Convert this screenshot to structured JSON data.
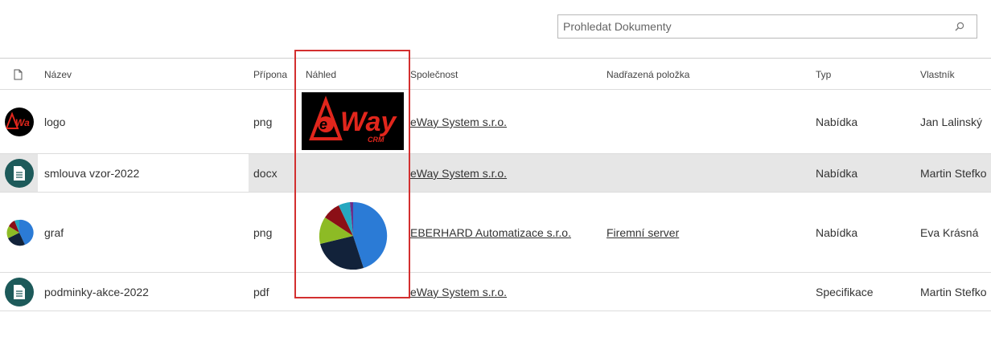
{
  "search": {
    "placeholder": "Prohledat Dokumenty"
  },
  "columns": {
    "name": "Název",
    "extension": "Přípona",
    "preview": "Náhled",
    "company": "Společnost",
    "parent": "Nadřazená položka",
    "type": "Typ",
    "owner": "Vlastník"
  },
  "rows": [
    {
      "name": "logo",
      "extension": "png",
      "company": "eWay System s.r.o.",
      "parent": "",
      "type": "Nabídka",
      "owner": "Jan Lalinský",
      "preview": "eway-logo",
      "avatar": "eway-logo"
    },
    {
      "name": "smlouva vzor-2022",
      "extension": "docx",
      "company": "eWay System s.r.o.",
      "parent": "",
      "type": "Nabídka",
      "owner": "Martin Stefko",
      "preview": "none",
      "avatar": "document-icon"
    },
    {
      "name": "graf",
      "extension": "png",
      "company": "EBERHARD Automatizace s.r.o.",
      "parent": "Firemní server",
      "type": "Nabídka",
      "owner": "Eva Krásná",
      "preview": "pie-chart",
      "avatar": "pie-chart"
    },
    {
      "name": "podminky-akce-2022",
      "extension": "pdf",
      "company": "eWay System s.r.o.",
      "parent": "",
      "type": "Specifikace",
      "owner": "Martin Stefko",
      "preview": "none",
      "avatar": "document-icon"
    }
  ],
  "logo_text": {
    "brand": "eWay",
    "sub": "CRM"
  },
  "colors": {
    "highlight_box": "#d32f2f",
    "selected_row": "#e6e6e6",
    "doc_avatar": "#1d5a5a",
    "logo_red": "#e1261c"
  }
}
